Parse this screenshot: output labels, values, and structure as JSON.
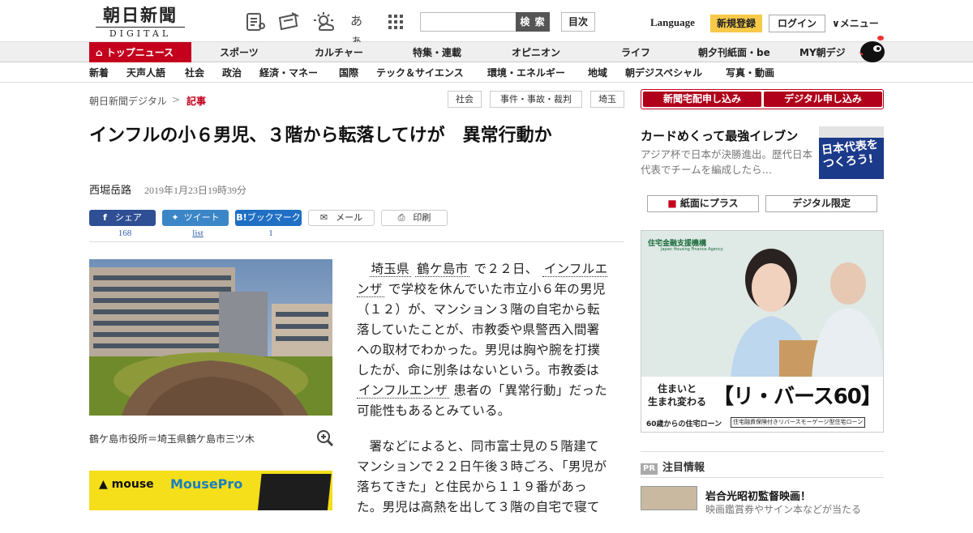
{
  "header": {
    "logo_jp": "朝日新聞",
    "logo_en": "DIGITAL",
    "icons": [
      "newspaper-icon",
      "rss-icon",
      "weather-icon",
      "font-size-icon",
      "grid-icon"
    ],
    "font_size_label": "あぁ",
    "search_button": "検 索",
    "toc_button": "目次",
    "language": "Language",
    "signup": "新規登録",
    "login": "ログイン",
    "menu": "メニュー"
  },
  "nav_primary": [
    "トップニュース",
    "スポーツ",
    "カルチャー",
    "特集・連載",
    "オピニオン",
    "ライフ",
    "朝夕刊紙面・be",
    "MY朝デジ"
  ],
  "nav_secondary": [
    "新着",
    "天声人語",
    "社会",
    "政治",
    "経済・マネー",
    "国際",
    "テック＆サイエンス",
    "環境・エネルギー",
    "地域",
    "朝デジスペシャル",
    "写真・動画"
  ],
  "breadcrumb": {
    "home": "朝日新聞デジタル",
    "sep": ">",
    "current": "記事"
  },
  "tags": [
    "社会",
    "事件・事故・裁判",
    "埼玉"
  ],
  "subscribe": {
    "paper": "新聞宅配申し込み",
    "digital": "デジタル申し込み"
  },
  "article": {
    "title": "インフルの小６男児、３階から転落してけが　異常行動か",
    "author": "西堀岳路",
    "date": "2019年1月23日19時39分",
    "share": {
      "facebook": "シェア",
      "facebook_count": "168",
      "twitter": "ツイート",
      "twitter_count": "list",
      "hatena": "ブックマーク",
      "hatena_count": "1",
      "mail": "メール",
      "print": "印刷"
    },
    "caption": "鶴ケ島市役所＝埼玉県鶴ケ島市三ツ木",
    "p1": {
      "l1": "埼玉県",
      "l2": "鶴ケ島市",
      "t1": "で２２日、",
      "l3": "インフルエンザ",
      "t2": "で学校を休んでいた市立小６年の男児（１２）が、マンション３階の自宅から転落していたことが、市教委や県警西入間署への取材でわかった。男児は胸や腕を打撲したが、命に別条はないという。市教委は",
      "l4": "インフルエンザ",
      "t3": "患者の「異常行動」だった可能性もあるとみている。"
    },
    "p2": "署などによると、同市富士見の５階建てマンションで２２日午後３時ごろ、「男児が落ちてきた」と住民から１１９番があった。男児は高熱を出して３階の自宅で寝て"
  },
  "ad_mouse": {
    "brand": "mouse",
    "product": "MousePro"
  },
  "sidebar": {
    "feature_title": "カードめくって最強イレブン",
    "feature_desc": "アジア杯で日本が決勝進出。歴代日本代表でチームを編成したら…",
    "feature_image_text": "日本代表をつくろう!",
    "btn_paper": "紙面にプラス",
    "btn_digital": "デジタル限定",
    "ad": {
      "agency": "住宅金融支援機構",
      "agency_en": "Japan Housing Finance Agency",
      "line1": "住まいと",
      "line2": "生まれ変わる",
      "brand": "【リ・バース60】",
      "sub1": "60歳からの住宅ローン",
      "sub2": "住宅融資保険付きリバースモーゲージ型住宅ローン"
    },
    "pr_badge": "PR",
    "pr_label": "注目情報",
    "pr_item_title": "岩合光昭初監督映画！",
    "pr_item_desc": "映画鑑賞券やサイン本などが当たる"
  },
  "colors": {
    "brand_red": "#c4001d",
    "share_blue": "#2f5fa8",
    "signup_yellow": "#f7c948"
  }
}
